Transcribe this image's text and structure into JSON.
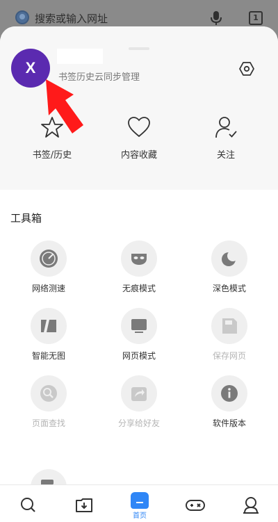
{
  "browser_bar": {
    "search_placeholder": "搜索或输入网址",
    "tabs_count": "1"
  },
  "profile": {
    "avatar_letter": "X",
    "subtitle": "书签历史云同步管理"
  },
  "quick_actions": [
    {
      "label": "书签/历史",
      "icon": "star-icon"
    },
    {
      "label": "内容收藏",
      "icon": "heart-icon"
    },
    {
      "label": "关注",
      "icon": "follow-user-icon"
    }
  ],
  "toolbox": {
    "title": "工具箱",
    "items": [
      {
        "label": "网络测速",
        "icon": "speedometer-icon",
        "enabled": true
      },
      {
        "label": "无痕模式",
        "icon": "mask-icon",
        "enabled": true
      },
      {
        "label": "深色模式",
        "icon": "moon-icon",
        "enabled": true
      },
      {
        "label": "智能无图",
        "icon": "no-image-icon",
        "enabled": true
      },
      {
        "label": "网页模式",
        "icon": "monitor-icon",
        "enabled": true
      },
      {
        "label": "保存网页",
        "icon": "save-page-icon",
        "enabled": false
      },
      {
        "label": "页面查找",
        "icon": "find-in-page-icon",
        "enabled": false
      },
      {
        "label": "分享给好友",
        "icon": "share-icon",
        "enabled": false
      },
      {
        "label": "软件版本",
        "icon": "info-icon",
        "enabled": true
      },
      {
        "label": "",
        "icon": "exit-icon",
        "enabled": true
      }
    ]
  },
  "bottom_nav": {
    "home_label": "首页"
  },
  "colors": {
    "accent": "#2f86f6",
    "avatar_bg": "#5b2ab0",
    "annotation_arrow": "#ff0000"
  }
}
